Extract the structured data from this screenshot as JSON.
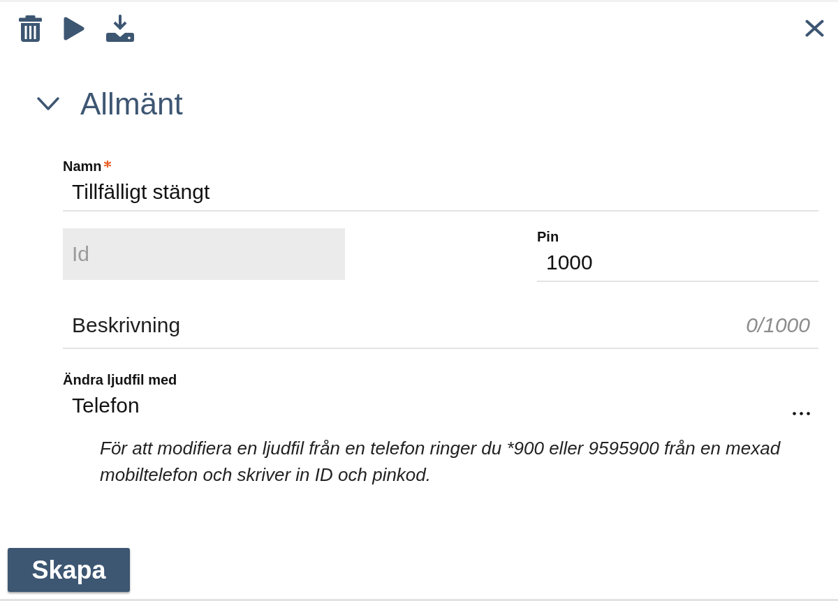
{
  "section": {
    "title": "Allmänt",
    "expanded": true
  },
  "name_field": {
    "label": "Namn",
    "required": true,
    "value": "Tillfälligt stängt"
  },
  "id_field": {
    "placeholder": "Id",
    "disabled": true
  },
  "pin_field": {
    "label": "Pin",
    "value": "1000"
  },
  "description_field": {
    "placeholder": "Beskrivning",
    "counter": "0/1000"
  },
  "audio_field": {
    "label": "Ändra ljudfil med",
    "value": "Telefon",
    "help_text": "För att modifiera en ljudfil från en telefon ringer du *900 eller 9595900 från en mexad mobiltelefon och skriver in ID och pinkod."
  },
  "submit_button": {
    "label": "Skapa"
  }
}
